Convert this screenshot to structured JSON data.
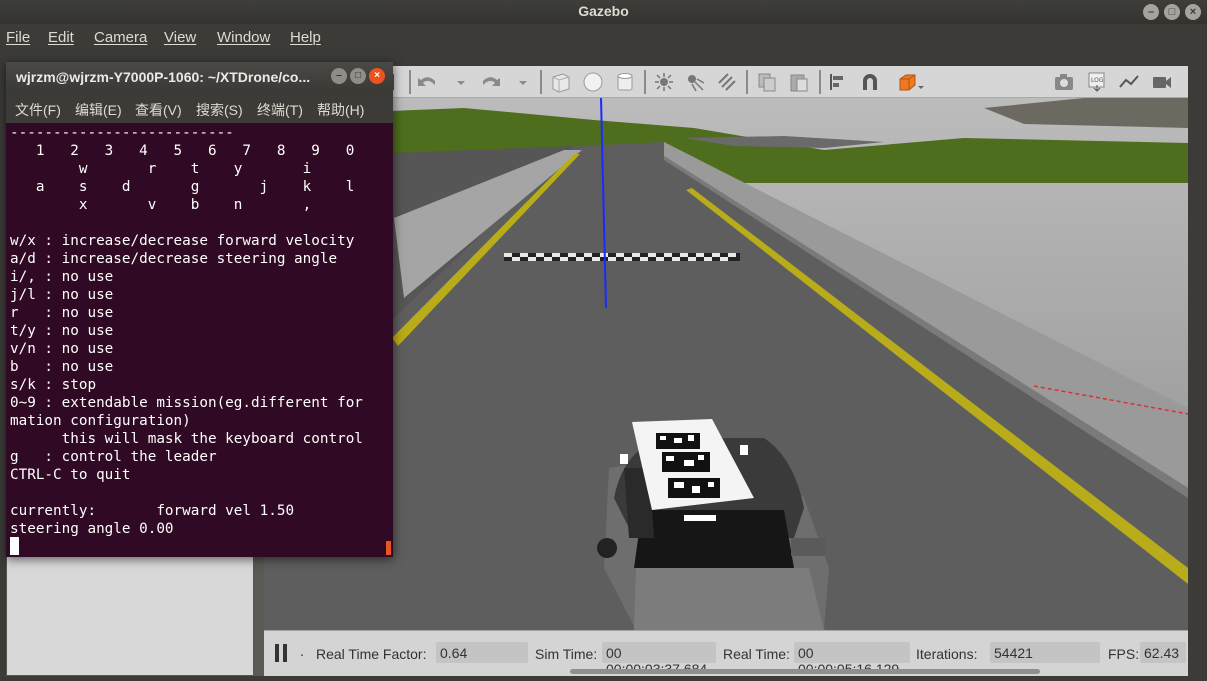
{
  "window": {
    "title": "Gazebo"
  },
  "menubar": [
    "File",
    "Edit",
    "Camera",
    "View",
    "Window",
    "Help"
  ],
  "toolbar": {
    "icons": [
      "arrow-select-icon",
      "undo-icon",
      "undo-dropdown-icon",
      "redo-icon",
      "redo-dropdown-icon",
      "box-shape-icon",
      "sphere-shape-icon",
      "cylinder-shape-icon",
      "point-light-icon",
      "spot-light-icon",
      "directional-light-icon",
      "copy-icon",
      "paste-icon",
      "align-icon",
      "snap-icon",
      "change-view-icon",
      "screenshot-icon",
      "log-icon",
      "plot-icon",
      "record-video-icon"
    ]
  },
  "terminal": {
    "title": "wjrzm@wjrzm-Y7000P-1060: ~/XTDrone/co...",
    "menu": [
      "文件(F)",
      "编辑(E)",
      "查看(V)",
      "搜索(S)",
      "终端(T)",
      "帮助(H)"
    ],
    "lines": [
      "--------------------------",
      "   1   2   3   4   5   6   7   8   9   0",
      "        w       r    t    y       i",
      "   a    s    d       g       j    k    l",
      "        x       v    b    n       ,",
      "",
      "w/x : increase/decrease forward velocity",
      "a/d : increase/decrease steering angle",
      "i/, : no use",
      "j/l : no use",
      "r   : no use",
      "t/y : no use",
      "v/n : no use",
      "b   : no use",
      "s/k : stop",
      "0~9 : extendable mission(eg.different for",
      "mation configuration)",
      "      this will mask the keyboard control",
      "g   : control the leader",
      "CTRL-C to quit",
      "",
      "currently:       forward vel 1.50",
      "steering angle 0.00"
    ]
  },
  "statusbar": {
    "step_marker": ".",
    "real_time_factor_label": "Real Time Factor:",
    "real_time_factor": "0.64",
    "sim_time_label": "Sim Time:",
    "sim_time": "00 00:00:03:37.684",
    "real_time_label": "Real Time:",
    "real_time": "00 00:00:05:16.129",
    "iterations_label": "Iterations:",
    "iterations": "54421",
    "fps_label": "FPS:",
    "fps": "62.43"
  },
  "colors": {
    "terminal_bg": "#300a24",
    "accent": "#e95420",
    "road": "#5f5f5f",
    "lane_yellow": "#b8ac1a",
    "grass": "#4c6a1c"
  }
}
